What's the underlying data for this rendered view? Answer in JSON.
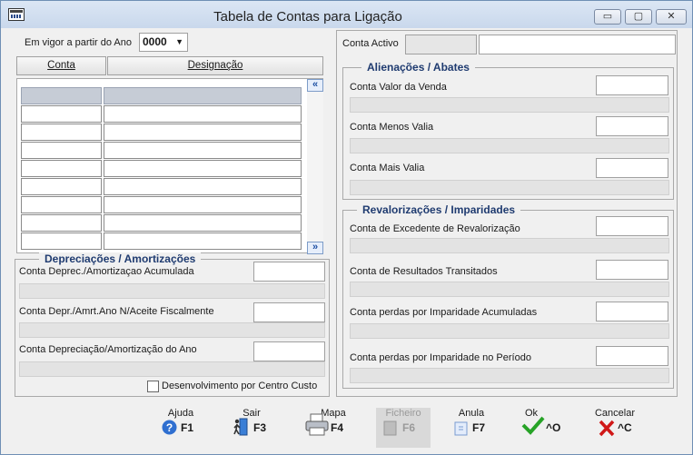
{
  "window": {
    "title": "Tabela de Contas para Ligação"
  },
  "titlebar_buttons": [
    "▭",
    "▢",
    "✕"
  ],
  "left": {
    "year_label": "Em vigor a partir do Ano",
    "year_value": "0000",
    "columns": [
      "Conta",
      "Designação"
    ],
    "scroll_up": "«",
    "scroll_down": "»",
    "depreciacoes": {
      "title": "Depreciações / Amortizações",
      "fields": [
        "Conta Deprec./Amortizaçao Acumulada",
        "Conta Depr./Amrt.Ano N/Aceite Fiscalmente",
        "Conta Depreciação/Amortização do Ano"
      ],
      "checkbox_label": "Desenvolvimento por Centro Custo"
    }
  },
  "right": {
    "conta_activo_label": "Conta Activo",
    "alienacoes": {
      "title": "Alienações / Abates",
      "fields": [
        "Conta Valor da Venda",
        "Conta Menos Valia",
        "Conta Mais Valia"
      ]
    },
    "revalorizacoes": {
      "title": "Revalorizações / Imparidades",
      "fields": [
        "Conta de Excedente de Revalorização",
        "Conta de Resultados Transitados",
        "Conta perdas por Imparidade Acumuladas",
        "Conta perdas por Imparidade no Período"
      ]
    }
  },
  "footer": {
    "keys": [
      {
        "name": "help",
        "caption": "Ajuda",
        "key": "F1",
        "icon": "help-icon",
        "enabled": true
      },
      {
        "name": "exit",
        "caption": "Sair",
        "key": "F3",
        "icon": "exit-door-icon",
        "enabled": true
      },
      {
        "name": "map",
        "caption": "Mapa",
        "key": "F4",
        "icon": "printer-icon",
        "enabled": true
      },
      {
        "name": "file",
        "caption": "Ficheiro",
        "key": "F6",
        "icon": "file-icon",
        "enabled": false
      },
      {
        "name": "undo",
        "caption": "Anula",
        "key": "F7",
        "icon": "undo-icon",
        "enabled": true
      },
      {
        "name": "ok",
        "caption": "Ok",
        "key": "^O",
        "icon": "checkmark-icon",
        "enabled": true
      },
      {
        "name": "cancel",
        "caption": "Cancelar",
        "key": "^C",
        "icon": "cross-icon",
        "enabled": true
      }
    ]
  },
  "colors": {
    "legend": "#1f3b70",
    "ok": "#27a327",
    "cancel": "#d01818"
  }
}
